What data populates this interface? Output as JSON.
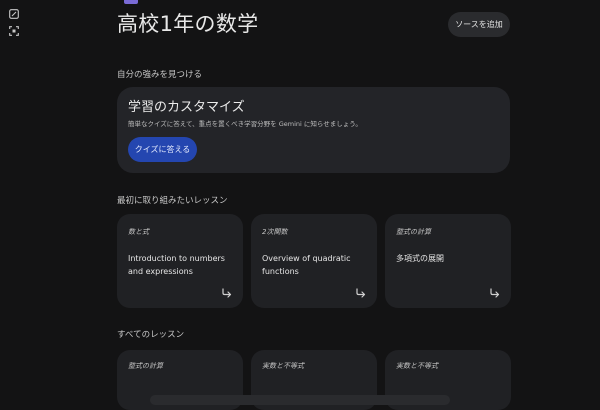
{
  "header": {
    "title": "高校1年の数学",
    "add_source_label": "ソースを追加"
  },
  "sidebar": {
    "icons": [
      "edit-icon",
      "scan-icon"
    ]
  },
  "strengths": {
    "section_label": "自分の強みを見つける",
    "card_title": "学習のカスタマイズ",
    "card_description": "簡単なクイズに答えて、重点を置くべき学習分野を Gemini に知らせましょう。",
    "quiz_button_label": "クイズに答える"
  },
  "first_lessons": {
    "section_label": "最初に取り組みたいレッスン",
    "cards": [
      {
        "category": "数と式",
        "title": "Introduction to numbers and expressions"
      },
      {
        "category": "2次関数",
        "title": "Overview of quadratic functions"
      },
      {
        "category": "整式の計算",
        "title": "多項式の展開"
      }
    ]
  },
  "all_lessons": {
    "section_label": "すべてのレッスン",
    "cards": [
      {
        "category": "整式の計算"
      },
      {
        "category": "実数と不等式"
      },
      {
        "category": "実数と不等式"
      }
    ]
  },
  "colors": {
    "background": "#131314",
    "card": "#202124",
    "accent_button": "#2446b0"
  }
}
